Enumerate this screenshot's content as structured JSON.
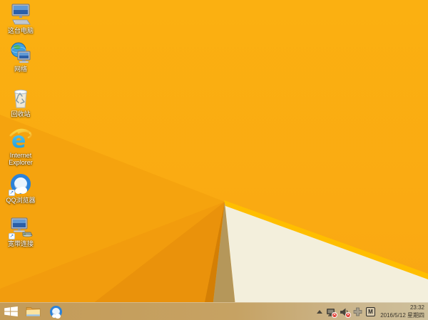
{
  "theme": {
    "wallpaper_base": "#FBB011",
    "wallpaper_base_deep": "#F9A712",
    "wallpaper_facet_a": "#F5A30E",
    "wallpaper_facet_b": "#F29C0D",
    "wallpaper_facet_c": "#EA920B",
    "wallpaper_sliver": "#D47F05",
    "wallpaper_tan": "#B5975A",
    "wallpaper_cream": "#F3EFDC",
    "wallpaper_stripe": "#FFBE00",
    "taskbar_left": "#C49B58",
    "taskbar_right": "#CEC09C",
    "badge_red": "#E03C31",
    "ie_blue": "#2BA6E8",
    "qq_blue": "#2B82D9",
    "label_text": "#FFFFFF",
    "tray_glyph": "#4A463C"
  },
  "desktop": {
    "icons": [
      {
        "name": "this-pc",
        "icon": "computer-icon",
        "label": "这台电脑"
      },
      {
        "name": "network",
        "icon": "globe-computer-icon",
        "label": "网络"
      },
      {
        "name": "recycle-bin",
        "icon": "recycle-bin-icon",
        "label": "回收站"
      },
      {
        "name": "internet-explorer",
        "icon": "ie-logo-icon",
        "label": "Internet Explorer"
      },
      {
        "name": "qq-browser",
        "icon": "qq-browser-logo-icon",
        "label": "QQ浏览器"
      },
      {
        "name": "broadband-connection",
        "icon": "computer-modem-icon",
        "label": "宽带连接"
      }
    ]
  },
  "taskbar": {
    "buttons": [
      {
        "name": "start",
        "icon": "windows-logo-icon"
      },
      {
        "name": "file-explorer",
        "icon": "folder-icon"
      },
      {
        "name": "qq-browser",
        "icon": "qq-browser-logo-icon"
      }
    ],
    "tray": {
      "icons": [
        "hidden-icons-caret",
        "network-disconnected-icon",
        "volume-muted-icon",
        "ime-cross-icon",
        "ime-mode-indicator"
      ],
      "network_badge": "x",
      "volume_badge": "x",
      "ime_mode": "M",
      "clock_time": "23:32",
      "clock_date": "2016/5/12 星期四"
    }
  }
}
